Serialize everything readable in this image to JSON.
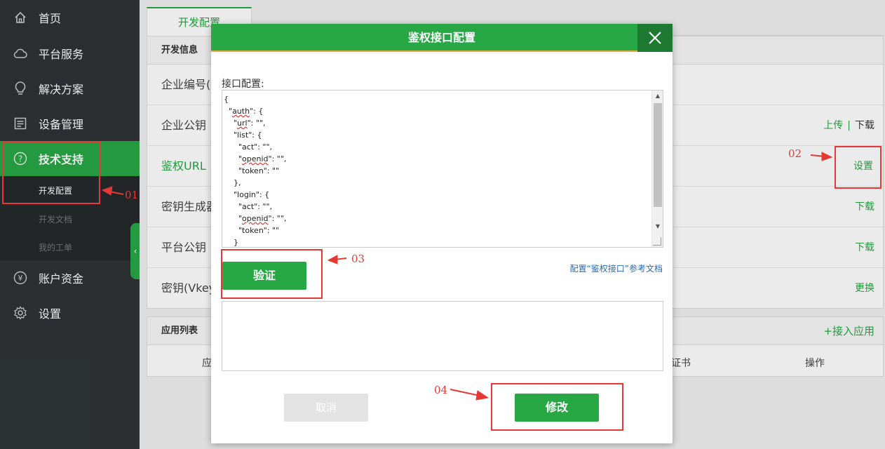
{
  "sidebar": {
    "items": [
      {
        "label": "首页",
        "icon": "home-icon"
      },
      {
        "label": "平台服务",
        "icon": "cloud-icon"
      },
      {
        "label": "解决方案",
        "icon": "lightbulb-icon"
      },
      {
        "label": "设备管理",
        "icon": "list-icon"
      },
      {
        "label": "技术支持",
        "icon": "help-circle-icon"
      },
      {
        "label": "账户资金",
        "icon": "yen-icon"
      },
      {
        "label": "设置",
        "icon": "gear-icon"
      }
    ],
    "subitems": [
      "开发配置",
      "开发文档",
      "我的工单"
    ],
    "collapse": "‹"
  },
  "main": {
    "tab": "开发配置",
    "panel_title": "开发信息",
    "rows": [
      {
        "label": "企业编号(",
        "action": ""
      },
      {
        "label": "企业公钥",
        "action": "上传",
        "sep": "|",
        "action2": "下载"
      },
      {
        "label": "鉴权URL",
        "action": "设置"
      },
      {
        "label": "密钥生成器",
        "action": "下载"
      },
      {
        "label": "平台公钥",
        "action": "下载"
      },
      {
        "label": "密钥(Vkey",
        "action": "更换"
      }
    ],
    "app_list": {
      "title": "应用列表",
      "add": "+接入应用",
      "cols": [
        "应",
        "证书",
        "操作"
      ]
    }
  },
  "modal": {
    "title": "鉴权接口配置",
    "config_label": "接口配置:",
    "code_lines": [
      "{",
      "  \"auth\": {",
      "    \"url\": \"\",",
      "    \"list\": {",
      "      \"act\": \"\",",
      "      \"openid\": \"\",",
      "      \"token\": \"\"",
      "    },",
      "    \"login\": {",
      "      \"act\": \"\",",
      "      \"openid\": \"\",",
      "      \"token\": \"\"",
      "    }"
    ],
    "verify": "验证",
    "doc_link": "配置“鉴权接口”参考文档",
    "cancel": "取消",
    "modify": "修改"
  },
  "annotations": [
    "01",
    "02",
    "03",
    "04"
  ],
  "colors": {
    "accent": "#28a745",
    "sidebar": "#2f3437",
    "annotation": "#e53935"
  }
}
